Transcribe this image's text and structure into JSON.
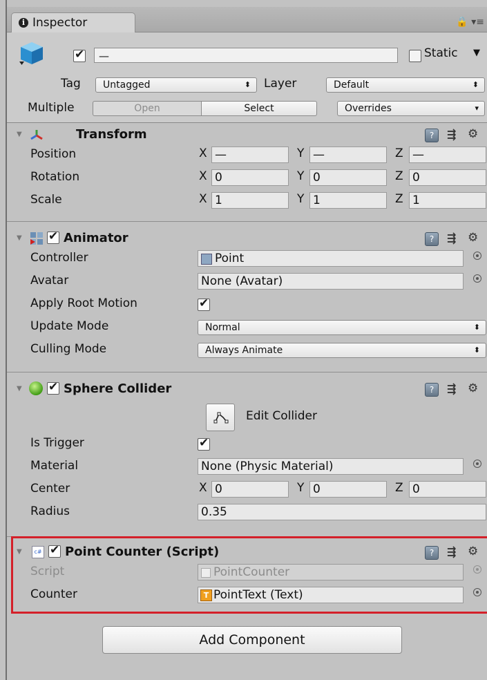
{
  "tab": {
    "title": "Inspector"
  },
  "header": {
    "name_value": "—",
    "static_label": "Static",
    "tag_label": "Tag",
    "tag_value": "Untagged",
    "layer_label": "Layer",
    "layer_value": "Default",
    "multiple_label": "Multiple",
    "open_label": "Open",
    "select_label": "Select",
    "overrides_label": "Overrides"
  },
  "transform": {
    "title": "Transform",
    "position_label": "Position",
    "rotation_label": "Rotation",
    "scale_label": "Scale",
    "axis_x": "X",
    "axis_y": "Y",
    "axis_z": "Z",
    "position": {
      "x": "—",
      "y": "—",
      "z": "—"
    },
    "rotation": {
      "x": "0",
      "y": "0",
      "z": "0"
    },
    "scale": {
      "x": "1",
      "y": "1",
      "z": "1"
    }
  },
  "animator": {
    "title": "Animator",
    "controller_label": "Controller",
    "controller_value": "Point",
    "avatar_label": "Avatar",
    "avatar_value": "None (Avatar)",
    "apply_root_motion_label": "Apply Root Motion",
    "update_mode_label": "Update Mode",
    "update_mode_value": "Normal",
    "culling_mode_label": "Culling Mode",
    "culling_mode_value": "Always Animate"
  },
  "sphere_collider": {
    "title": "Sphere Collider",
    "edit_collider_label": "Edit Collider",
    "is_trigger_label": "Is Trigger",
    "material_label": "Material",
    "material_value": "None (Physic Material)",
    "center_label": "Center",
    "center": {
      "x": "0",
      "y": "0",
      "z": "0"
    },
    "radius_label": "Radius",
    "radius_value": "0.35"
  },
  "point_counter": {
    "title": "Point Counter (Script)",
    "script_label": "Script",
    "script_value": "PointCounter",
    "counter_label": "Counter",
    "counter_value": "PointText (Text)"
  },
  "add_component_label": "Add Component"
}
